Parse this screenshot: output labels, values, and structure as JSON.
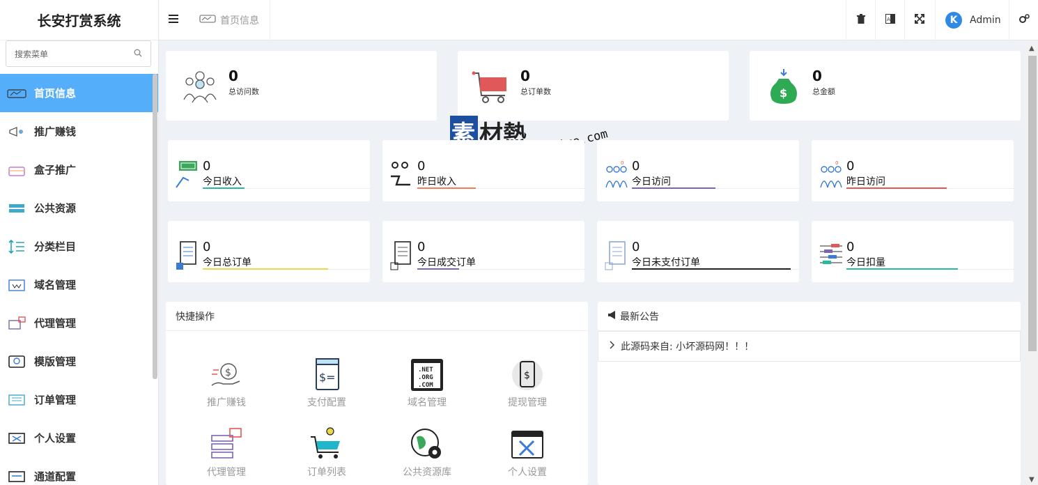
{
  "app": {
    "title": "长安打赏系统"
  },
  "search": {
    "placeholder": "搜索菜单"
  },
  "sidebar": {
    "items": [
      {
        "label": "首页信息",
        "icon": "home-info-icon",
        "active": true
      },
      {
        "label": "推广赚钱",
        "icon": "megaphone-icon"
      },
      {
        "label": "盒子推广",
        "icon": "box-icon"
      },
      {
        "label": "公共资源",
        "icon": "resource-icon"
      },
      {
        "label": "分类栏目",
        "icon": "sort-icon"
      },
      {
        "label": "域名管理",
        "icon": "domain-icon"
      },
      {
        "label": "代理管理",
        "icon": "agent-icon"
      },
      {
        "label": "模版管理",
        "icon": "html-template-icon"
      },
      {
        "label": "订单管理",
        "icon": "order-icon"
      },
      {
        "label": "个人设置",
        "icon": "settings-icon"
      },
      {
        "label": "通道配置",
        "icon": "channel-icon"
      }
    ]
  },
  "topbar": {
    "breadcrumb": "首页信息",
    "user": "Admin",
    "user_initial": "K"
  },
  "stats_big": [
    {
      "value": "0",
      "label": "总访问数",
      "icon": "visitors-icon"
    },
    {
      "value": "0",
      "label": "总订单数",
      "icon": "cart-icon"
    },
    {
      "value": "0",
      "label": "总金额",
      "icon": "money-bag-icon"
    }
  ],
  "stats_small": [
    {
      "value": "0",
      "label": "今日收入",
      "icon": "income-icon",
      "color": "#26b99a"
    },
    {
      "value": "0",
      "label": "昨日收入",
      "icon": "yesterday-income-icon",
      "color": "#f27c5a"
    },
    {
      "value": "0",
      "label": "今日访问",
      "icon": "visit-icon",
      "color": "#7b64b4"
    },
    {
      "value": "0",
      "label": "昨日访问",
      "icon": "visit-icon",
      "color": "#e65454"
    },
    {
      "value": "0",
      "label": "今日总订单",
      "icon": "order-total-icon",
      "color": "#e9d84c"
    },
    {
      "value": "0",
      "label": "今日成交订单",
      "icon": "order-deal-icon",
      "color": "#7b64b4"
    },
    {
      "value": "0",
      "label": "今日未支付订单",
      "icon": "order-unpaid-icon",
      "color": "#222222"
    },
    {
      "value": "0",
      "label": "今日扣量",
      "icon": "deduct-icon",
      "color": "#26b99a"
    }
  ],
  "quick": {
    "title": "快捷操作",
    "items": [
      {
        "label": "推广赚钱",
        "icon": "money-hand-icon"
      },
      {
        "label": "支付配置",
        "icon": "payment-config-icon"
      },
      {
        "label": "域名管理",
        "icon": "domain-list-icon"
      },
      {
        "label": "提现管理",
        "icon": "withdraw-icon"
      },
      {
        "label": "代理管理",
        "icon": "agent-server-icon"
      },
      {
        "label": "订单列表",
        "icon": "order-cart-icon"
      },
      {
        "label": "公共资源库",
        "icon": "globe-gear-icon"
      },
      {
        "label": "个人设置",
        "icon": "tools-window-icon"
      }
    ]
  },
  "notice": {
    "title": "最新公告",
    "items": [
      "此源码来自: 小坏源码网！！！"
    ]
  },
  "watermark": {
    "brand": "素材熱",
    "url": "sucaire.com"
  }
}
